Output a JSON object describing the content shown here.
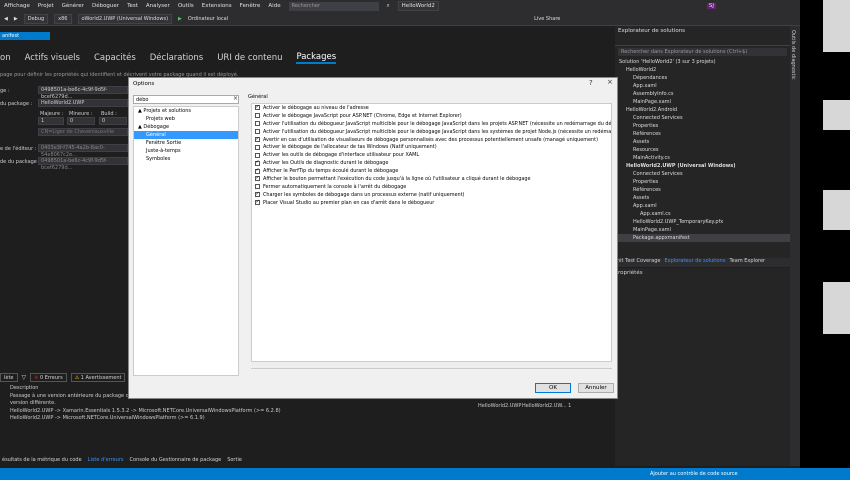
{
  "menu": {
    "items": [
      "Affichage",
      "Projet",
      "Générer",
      "Déboguer",
      "Test",
      "Analyser",
      "Outils",
      "Extensions",
      "Fenêtre",
      "Aide"
    ],
    "search_placeholder": "Rechercher",
    "solution_name": "HelloWorld2"
  },
  "toolbar": {
    "config": "Debug",
    "platform": "x86",
    "startup": "oWorld2.UWP (Universal Windows)",
    "target": "Ordinateur local",
    "live_share": "Live Share",
    "avatar": "SJ"
  },
  "doc_tab": "anifest",
  "manifest": {
    "tabs": [
      "on",
      "Actifs visuels",
      "Capacités",
      "Déclarations",
      "URI de contenu",
      "Packages"
    ],
    "active_tab": "Packages",
    "description": "page pour définir les propriétés qui identifient et décrivent votre package quand il est déployé.",
    "fields": [
      {
        "label": "ge :",
        "value": "0498501a-be6c-4c9f-9d5f-bcef6279d..."
      },
      {
        "label": "du package :",
        "value": "HelloWorld2.UWP"
      },
      {
        "label": "",
        "value": "CN=Liger de Chevenlauxville"
      },
      {
        "label": "e de l'éditeur :",
        "value": "0403e3f-f745-4a2b-8ac0-54e8067c2e..."
      },
      {
        "label": "de du package :",
        "value": "0498501a-be6c-4c9f-9d5f-bcef6279d..."
      }
    ],
    "version_labels": [
      "Majeure :",
      "Mineure :",
      "Build :"
    ],
    "version_values": [
      "1",
      "0",
      "0"
    ]
  },
  "error_list": {
    "scope": "lète",
    "errors": "0 Erreurs",
    "warnings": "1 Avertissement",
    "col_description": "Description",
    "lines": [
      "Passage à une version antérieure du package détecté : Microsoft.NETCore.UniversalWindowsPlatform de 6.2.8 à 6.1.9. Référencez le package directement à partir du projet pour sélectionner une",
      "version différente.",
      "HelloWorld2.UWP -> Xamarin.Essentials 1.5.3.2 -> Microsoft.NETCore.UniversalWindowsPlatform (>= 6.2.8)",
      "HelloWorld2.UWP -> Microsoft.NETCore.UniversalWindowsPlatform (>= 6.1.9)"
    ],
    "project_col": "HelloWorld2.UWP",
    "file_col": "HelloWorld2.UW... 1"
  },
  "bottom_tabs": [
    "ésultats de la métrique du code",
    "Liste d'erreurs",
    "Console du Gestionnaire de package",
    "Sortie"
  ],
  "status": {
    "source_control": "Ajouter au contrôle de code source"
  },
  "solution_explorer": {
    "title": "Explorateur de solutions",
    "search_placeholder": "Rechercher dans Explorateur de solutions (Ctrl+$)",
    "items": [
      {
        "text": "Solution 'HelloWorld2' (3 sur 3 projets)",
        "indent": 0
      },
      {
        "text": "HelloWorld2",
        "indent": 1
      },
      {
        "text": "Dépendances",
        "indent": 2
      },
      {
        "text": "App.xaml",
        "indent": 2
      },
      {
        "text": "AssemblyInfo.cs",
        "indent": 2
      },
      {
        "text": "MainPage.xaml",
        "indent": 2
      },
      {
        "text": "HelloWorld2.Android",
        "indent": 1
      },
      {
        "text": "Connected Services",
        "indent": 2
      },
      {
        "text": "Properties",
        "indent": 2
      },
      {
        "text": "Références",
        "indent": 2
      },
      {
        "text": "Assets",
        "indent": 2
      },
      {
        "text": "Resources",
        "indent": 2
      },
      {
        "text": "MainActivity.cs",
        "indent": 2
      },
      {
        "text": "HelloWorld2.UWP (Universal Windows)",
        "indent": 1,
        "bold": true
      },
      {
        "text": "Connected Services",
        "indent": 2
      },
      {
        "text": "Properties",
        "indent": 2
      },
      {
        "text": "Références",
        "indent": 2
      },
      {
        "text": "Assets",
        "indent": 2
      },
      {
        "text": "App.xaml",
        "indent": 2
      },
      {
        "text": "App.xaml.cs",
        "indent": 3
      },
      {
        "text": "HelloWorld2.UWP_TemporaryKey.pfx",
        "indent": 2
      },
      {
        "text": "MainPage.xaml",
        "indent": 2
      },
      {
        "text": "Package.appxmanifest",
        "indent": 2,
        "selected": true
      }
    ],
    "bottom_tabs": [
      "nit Test Coverage",
      "Explorateur de solutions",
      "Team Explorer"
    ],
    "properties_title": "ropriétés"
  },
  "dialog": {
    "title": "Options",
    "help": "?",
    "close": "×",
    "tree_search": "débo",
    "tree": [
      {
        "text": "▲ Projets et solutions",
        "indent": 0
      },
      {
        "text": "Projets web",
        "indent": 2
      },
      {
        "text": "▲ Débogage",
        "indent": 0
      },
      {
        "text": "Général",
        "indent": 2,
        "selected": true
      },
      {
        "text": "Fenêtre Sortie",
        "indent": 2
      },
      {
        "text": "Juste-à-temps",
        "indent": 2
      },
      {
        "text": "Symboles",
        "indent": 2
      }
    ],
    "group": "Général",
    "options": [
      {
        "text": "Activer le débogage au niveau de l'adresse",
        "checked": true
      },
      {
        "text": "Activer le débogage JavaScript pour ASP.NET (Chrome, Edge et Internet Explorer)",
        "checked": false
      },
      {
        "text": "Activer l'utilisation du débogueur JavaScript multicible pour le débogage JavaScript dans les projets ASP.NET (nécessite un redémarrage du débogage)",
        "checked": false
      },
      {
        "text": "Activer l'utilisation du débogueur JavaScript multicible pour le débogage JavaScript dans les systèmes de projet Node.js (nécessite un redémarrage du",
        "checked": false
      },
      {
        "text": "Avertir en cas d'utilisation de visualiseurs de débogage personnalisés avec des processus potentiellement unsafe (managé uniquement)",
        "checked": true
      },
      {
        "text": "Activer le débogage de l'allocateur de tas Windows (Natif uniquement)",
        "checked": false
      },
      {
        "text": "Activer les outils de débogage d'interface utilisateur pour XAML",
        "checked": false
      },
      {
        "text": "Activer les Outils de diagnostic durant le débogage",
        "checked": true
      },
      {
        "text": "Afficher le PerfTip du temps écoulé durant le débogage",
        "checked": true
      },
      {
        "text": "Afficher le bouton permettant l'exécution du code jusqu'à la ligne où l'utilisateur a cliqué durant le débogage",
        "checked": true
      },
      {
        "text": "Fermer automatiquement la console à l'arrêt du débogage",
        "checked": false
      },
      {
        "text": "Charger les symboles de débogage dans un processus externe (natif uniquement)",
        "checked": true
      },
      {
        "text": "Placer Visual Studio au premier plan en cas d'arrêt dans le débogueur",
        "checked": true
      }
    ],
    "ok": "OK",
    "cancel": "Annuler"
  },
  "right_strip": "Outils de diagnostic"
}
